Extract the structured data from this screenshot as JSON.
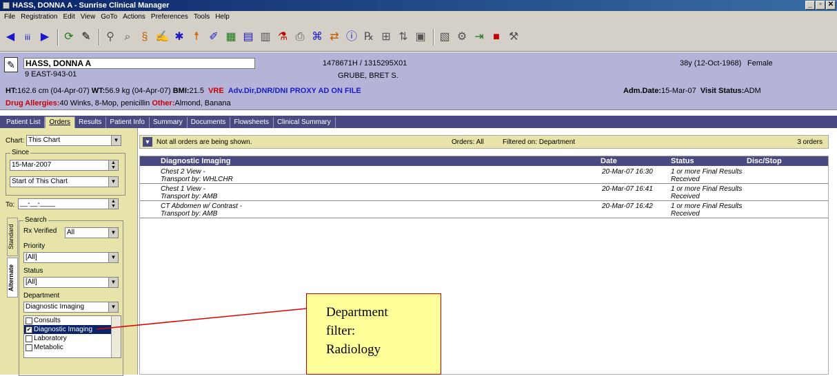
{
  "window": {
    "title": "HASS, DONNA A - Sunrise Clinical Manager",
    "controls": [
      "_",
      "▫",
      "✕"
    ]
  },
  "menu": [
    "File",
    "Registration",
    "Edit",
    "View",
    "GoTo",
    "Actions",
    "Preferences",
    "Tools",
    "Help"
  ],
  "toolbar_icons": [
    "back-arrow-icon",
    "patients-icon",
    "forward-arrow-icon",
    "refresh-icon",
    "notes-icon",
    "search-patient-icon",
    "find-icon",
    "vitals-icon",
    "edit-icon",
    "star-icon",
    "person-icon",
    "write-icon",
    "grid-icon",
    "chart-icon",
    "document-icon",
    "flask-icon",
    "print-icon",
    "results-icon",
    "transfer-icon",
    "info-icon",
    "rx-icon",
    "schedule-icon",
    "sort-icon",
    "table-icon",
    "flowsheet-icon",
    "tools-icon",
    "exit-icon",
    "save-icon",
    "wrench-icon"
  ],
  "patient": {
    "name": "HASS, DONNA A",
    "location": "9 EAST-943-01",
    "ids": "1478671H / 1315295X01",
    "physician": "GRUBE, BRET S.",
    "age_dob": "38y (12-Oct-1968)",
    "sex": "Female",
    "ht_label": "HT:",
    "ht_value": "162.6 cm  (04-Apr-07)",
    "wt_label": "WT:",
    "wt_value": "56.9 kg  (04-Apr-07)",
    "bmi_label": "BMI:",
    "bmi_value": "21.5",
    "vre": "VRE",
    "adv_dir": "Adv.Dir,DNR/DNI PROXY AD ON FILE",
    "adm_label": "Adm.Date:",
    "adm_value": "15-Mar-07",
    "visit_label": "Visit Status:",
    "visit_value": "ADM",
    "allergy_label": "Drug Allergies:",
    "allergy_value": "40 Winks, 8-Mop, penicillin",
    "other_label": "Other:",
    "other_value": "Almond, Banana"
  },
  "tabs": [
    {
      "label": "Patient List",
      "active": false
    },
    {
      "label": "Orders",
      "active": true
    },
    {
      "label": "Results",
      "active": false
    },
    {
      "label": "Patient Info",
      "active": false
    },
    {
      "label": "Summary",
      "active": false
    },
    {
      "label": "Documents",
      "active": false
    },
    {
      "label": "Flowsheets",
      "active": false
    },
    {
      "label": "Clinical Summary",
      "active": false
    }
  ],
  "left": {
    "chart_label": "Chart:",
    "chart_value": "This Chart",
    "since_label": "Since",
    "since_date": "15-Mar-2007",
    "since_option": "Start of This Chart",
    "to_label": "To:",
    "to_value": "__-__-____",
    "search_label": "Search",
    "rx_label": "Rx Verified",
    "rx_value": "All",
    "priority_label": "Priority",
    "priority_value": "[All]",
    "status_label": "Status",
    "status_value": "[All]",
    "dept_label": "Department",
    "dept_value": "Diagnostic Imaging",
    "vtab_standard": "Standard",
    "vtab_alternate": "Alternate",
    "dept_list": [
      {
        "label": "Consults",
        "checked": false,
        "selected": false
      },
      {
        "label": "Diagnostic Imaging",
        "checked": true,
        "selected": true
      },
      {
        "label": "Laboratory",
        "checked": false,
        "selected": false
      },
      {
        "label": "Metabolic",
        "checked": false,
        "selected": false
      }
    ]
  },
  "orders_bar": {
    "notice": "Not all orders are being shown.",
    "orders_filter": "Orders: All",
    "filtered_on": "Filtered on: Department",
    "count": "3 orders"
  },
  "grid": {
    "headers": {
      "name": "Diagnostic Imaging",
      "date": "Date",
      "status": "Status",
      "disc": "Disc/Stop"
    },
    "rows": [
      {
        "name": "Chest 2 View -",
        "transport": "Transport by: WHLCHR",
        "date": "20-Mar-07 16:30",
        "status1": "1 or more Final Results",
        "status2": "Received"
      },
      {
        "name": "Chest 1 View -",
        "transport": "Transport by: AMB",
        "date": "20-Mar-07 16:41",
        "status1": "1 or more Final Results",
        "status2": "Received"
      },
      {
        "name": "CT Abdomen w/ Contrast -",
        "transport": "Transport by: AMB",
        "date": "20-Mar-07 16:42",
        "status1": "1 or more Final Results",
        "status2": "Received"
      }
    ]
  },
  "callout": {
    "line1": "Department",
    "line2": "filter:",
    "line3": "Radiology"
  }
}
